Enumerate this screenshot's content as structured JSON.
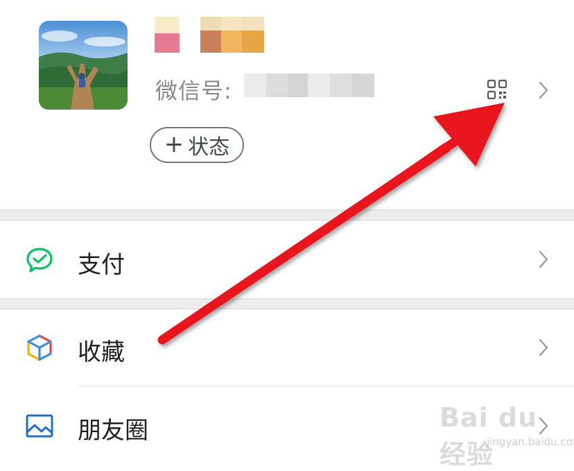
{
  "profile": {
    "wechat_id_label": "微信号:",
    "status_button": {
      "plus": "+",
      "label": "状态"
    }
  },
  "menu": [
    {
      "label": "支付",
      "icon": "wallet-check-icon",
      "color": "#07c160"
    },
    {
      "label": "收藏",
      "icon": "cube-icon",
      "color": "#3a8ee6"
    },
    {
      "label": "朋友圈",
      "icon": "picture-icon",
      "color": "#1d6fc9"
    }
  ],
  "annotation": {
    "arrow_color": "#e8161b"
  },
  "watermark": {
    "brand": "Bai du 经验",
    "site": "jingyan.baidu.com"
  }
}
